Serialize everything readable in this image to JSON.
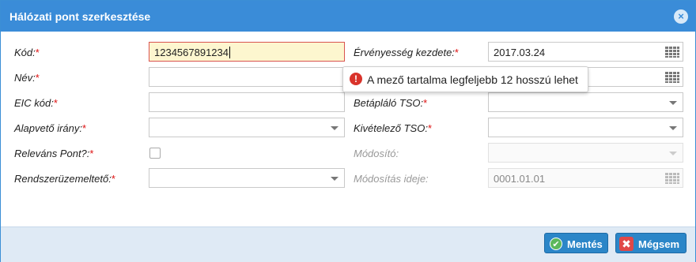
{
  "dialog": {
    "title": "Hálózati pont szerkesztése",
    "close_icon": "×"
  },
  "left": {
    "kod": {
      "label": "Kód:",
      "value": "1234567891234"
    },
    "nev": {
      "label": "Név:",
      "value": ""
    },
    "eic": {
      "label": "EIC kód:",
      "value": ""
    },
    "irany": {
      "label": "Alapvető irány:",
      "value": ""
    },
    "relevans": {
      "label": "Releváns Pont?:",
      "checked": false
    },
    "rendszer": {
      "label": "Rendszerüzemeltető:",
      "value": ""
    }
  },
  "right": {
    "ervenyesseg": {
      "label": "Érvényesség kezdete:",
      "value": "2017.03.24",
      "icon": "calendar-icon"
    },
    "vege": {
      "value": "",
      "icon": "calendar-icon"
    },
    "betaplalo": {
      "label": "Betápláló TSO:",
      "value": ""
    },
    "kivetelezo": {
      "label": "Kivételező TSO:",
      "value": ""
    },
    "modosito": {
      "label": "Módosító:",
      "value": ""
    },
    "modositas_ideje": {
      "label": "Módosítás ideje:",
      "value": "0001.01.01",
      "icon": "calendar-icon"
    }
  },
  "required_mark": "*",
  "tooltip": {
    "icon": "!",
    "text": "A mező tartalma legfeljebb 12 hosszú lehet"
  },
  "footer": {
    "save_label": "Mentés",
    "cancel_label": "Mégsem"
  }
}
